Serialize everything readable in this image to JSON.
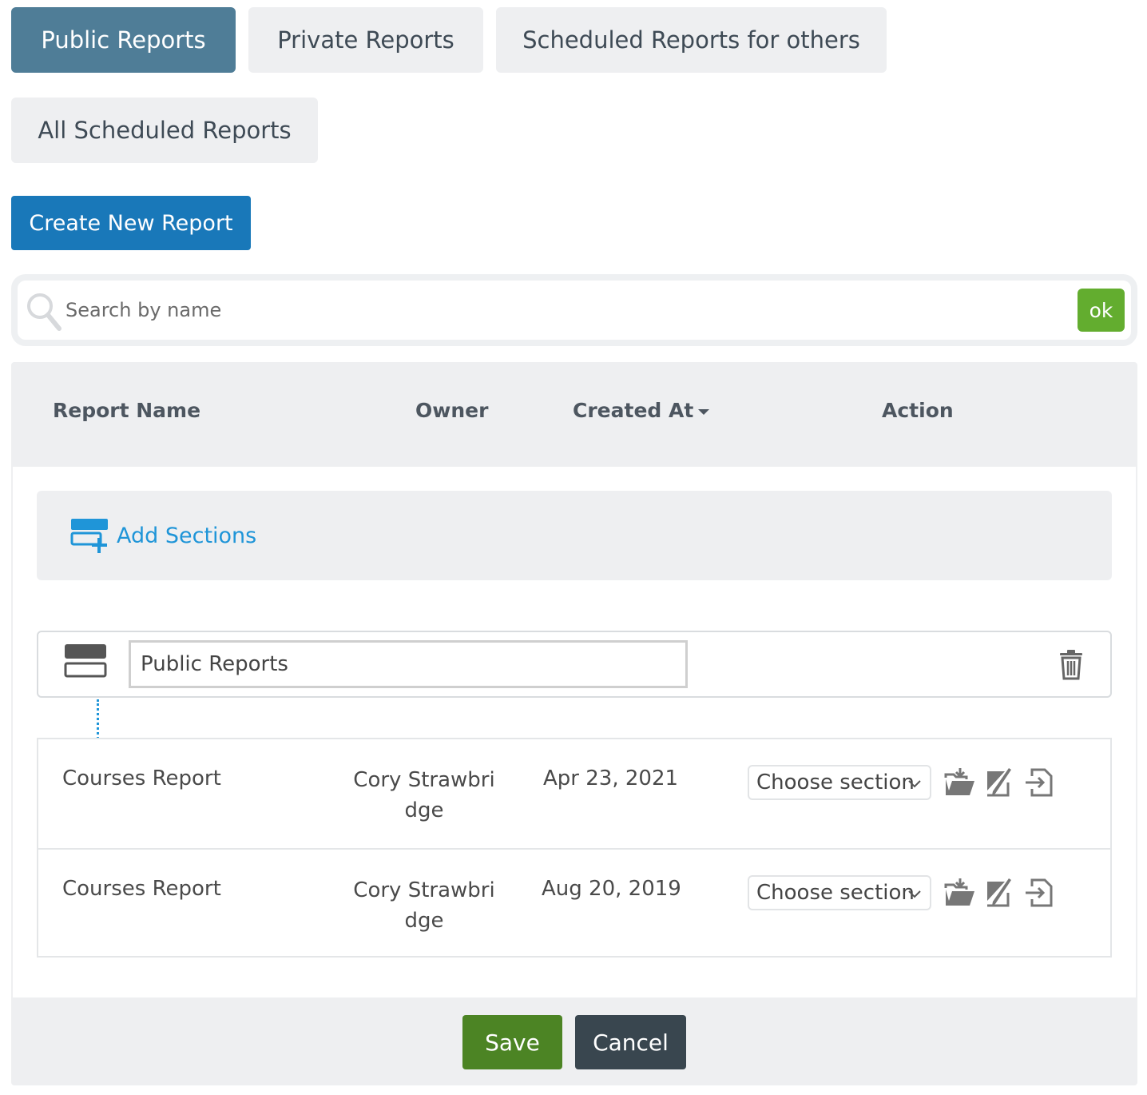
{
  "tabs": [
    {
      "label": "Public Reports",
      "active": true
    },
    {
      "label": "Private Reports",
      "active": false
    },
    {
      "label": "Scheduled Reports for others",
      "active": false
    },
    {
      "label": "All Scheduled Reports",
      "active": false
    }
  ],
  "create_button": "Create New Report",
  "search": {
    "placeholder": "Search by name",
    "value": "",
    "ok_label": "ok"
  },
  "table": {
    "headers": {
      "name": "Report Name",
      "owner": "Owner",
      "created": "Created At",
      "action": "Action"
    },
    "add_sections_label": "Add Sections",
    "section": {
      "name_value": "Public Reports"
    },
    "rows": [
      {
        "name": "Courses Report",
        "owner_line1": "Cory Strawbri",
        "owner_line2": "dge",
        "created": "Apr 23, 2021",
        "section_select": "Choose section"
      },
      {
        "name": "Courses Report",
        "owner_line1": "Cory Strawbri",
        "owner_line2": "dge",
        "created": "Aug 20, 2019",
        "section_select": "Choose section"
      }
    ]
  },
  "footer": {
    "save": "Save",
    "cancel": "Cancel"
  },
  "colors": {
    "active_tab": "#4f7d97",
    "create_button": "#1978b9",
    "ok_button": "#63ad2f",
    "save_button": "#4c8424",
    "cancel_button": "#39464f",
    "link": "#1f95d8"
  }
}
